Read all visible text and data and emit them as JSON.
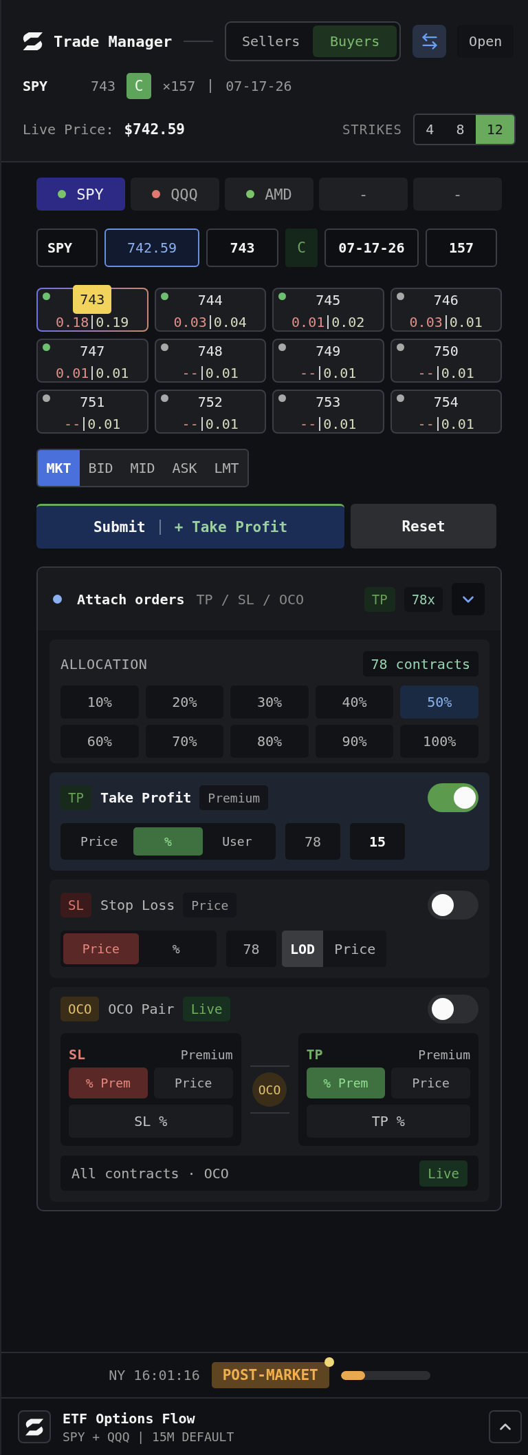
{
  "header": {
    "title": "Trade Manager",
    "side_tabs": [
      {
        "label": "Sellers",
        "selected": false
      },
      {
        "label": "Buyers",
        "selected": true
      }
    ],
    "open_button": "Open"
  },
  "contract": {
    "symbol": "SPY",
    "strike": "743",
    "type": "C",
    "quantity": "×157",
    "expiry": "07-17-26"
  },
  "live_price": {
    "label": "Live Price:",
    "value": "$742.59"
  },
  "strikes": {
    "label": "STRIKES",
    "options": [
      {
        "label": "4",
        "selected": false
      },
      {
        "label": "8",
        "selected": false
      },
      {
        "label": "12",
        "selected": true
      }
    ]
  },
  "tickers": [
    {
      "label": "SPY",
      "selected": true,
      "color": "#7cc46a"
    },
    {
      "label": "QQQ",
      "selected": false,
      "color": "#e07a6e"
    },
    {
      "label": "AMD",
      "selected": false,
      "color": "#7cc46a"
    },
    {
      "label": "-",
      "selected": false
    },
    {
      "label": "-",
      "selected": false
    }
  ],
  "order_fields": [
    {
      "kind": "input",
      "value": "SPY",
      "focused": false
    },
    {
      "kind": "input",
      "value": "742.59",
      "focused": true
    },
    {
      "kind": "input",
      "value": "743",
      "focused": false
    },
    {
      "kind": "tag",
      "value": "C"
    },
    {
      "kind": "input",
      "value": "07-17-26",
      "focused": false
    },
    {
      "kind": "input",
      "value": "157",
      "focused": false
    }
  ],
  "strike_grid": [
    {
      "strike": "743",
      "bid": "0.18",
      "ask": "0.19",
      "color": "#6cc070",
      "selected": true
    },
    {
      "strike": "744",
      "bid": "0.03",
      "ask": "0.04",
      "color": "#6cc070",
      "selected": false
    },
    {
      "strike": "745",
      "bid": "0.01",
      "ask": "0.02",
      "color": "#6cc070",
      "selected": false
    },
    {
      "strike": "746",
      "bid": "0.03",
      "ask": "0.01",
      "color": "#a8a8a8",
      "selected": false
    },
    {
      "strike": "747",
      "bid": "0.01",
      "ask": "0.01",
      "color": "#6cc070",
      "selected": false
    },
    {
      "strike": "748",
      "bid": "--",
      "ask": "0.01",
      "color": "#a8a8a8",
      "selected": false
    },
    {
      "strike": "749",
      "bid": "--",
      "ask": "0.01",
      "color": "#a8a8a8",
      "selected": false
    },
    {
      "strike": "750",
      "bid": "--",
      "ask": "0.01",
      "color": "#a8a8a8",
      "selected": false
    },
    {
      "strike": "751",
      "bid": "--",
      "ask": "0.01",
      "color": "#a8a8a8",
      "selected": false
    },
    {
      "strike": "752",
      "bid": "--",
      "ask": "0.01",
      "color": "#a8a8a8",
      "selected": false
    },
    {
      "strike": "753",
      "bid": "--",
      "ask": "0.01",
      "color": "#a8a8a8",
      "selected": false
    },
    {
      "strike": "754",
      "bid": "--",
      "ask": "0.01",
      "color": "#a8a8a8",
      "selected": false
    }
  ],
  "order_types": [
    {
      "label": "MKT",
      "selected": true
    },
    {
      "label": "BID",
      "selected": false
    },
    {
      "label": "MID",
      "selected": false
    },
    {
      "label": "ASK",
      "selected": false
    },
    {
      "label": "LMT",
      "selected": false
    }
  ],
  "actions": {
    "submit": "Submit",
    "submit_extra": "+ Take Profit",
    "reset": "Reset"
  },
  "attach_orders": {
    "title": "Attach orders",
    "subtitle": "TP / SL / OCO",
    "badges": [
      {
        "kind": "tp",
        "label": "TP"
      },
      {
        "kind": "count",
        "label": "78x"
      }
    ],
    "expanded": true,
    "allocation": {
      "label": "ALLOCATION",
      "contracts": "78 contracts",
      "options": [
        {
          "label": "10%",
          "selected": false
        },
        {
          "label": "20%",
          "selected": false
        },
        {
          "label": "30%",
          "selected": false
        },
        {
          "label": "40%",
          "selected": false
        },
        {
          "label": "50%",
          "selected": true
        },
        {
          "label": "60%",
          "selected": false
        },
        {
          "label": "70%",
          "selected": false
        },
        {
          "label": "80%",
          "selected": false
        },
        {
          "label": "90%",
          "selected": false
        },
        {
          "label": "100%",
          "selected": false
        }
      ]
    },
    "take_profit": {
      "badge": "TP",
      "title": "Take Profit",
      "mode": "Premium",
      "on": true,
      "modes": [
        {
          "label": "Price",
          "selected": false
        },
        {
          "label": "%",
          "selected": true
        },
        {
          "label": "User",
          "selected": false
        }
      ],
      "contracts": "78",
      "value": "15"
    },
    "stop_loss": {
      "badge": "SL",
      "title": "Stop Loss",
      "mode": "Price",
      "on": false,
      "modes": [
        {
          "label": "Price",
          "selected": true
        },
        {
          "label": "%",
          "selected": false
        }
      ],
      "contracts": "78",
      "anchors": [
        {
          "label": "LOD",
          "selected": true
        },
        {
          "label": "Price",
          "selected": false
        }
      ]
    },
    "oco_pair": {
      "badge": "OCO",
      "title": "OCO Pair",
      "status": "Live",
      "on": false,
      "legs": [
        {
          "kind": "sl",
          "label": "SL",
          "mode": "Premium",
          "options": [
            {
              "label": "% Prem",
              "selected": true
            },
            {
              "label": "Price",
              "selected": false
            }
          ],
          "placeholder": "SL %"
        },
        {
          "kind": "tp",
          "label": "TP",
          "mode": "Premium",
          "options": [
            {
              "label": "% Prem",
              "selected": true
            },
            {
              "label": "Price",
              "selected": false
            }
          ],
          "placeholder": "TP %"
        }
      ],
      "link": "OCO",
      "footer": "All contracts · OCO",
      "footer_status": "Live"
    }
  },
  "status_bar": {
    "clock": "NY 16:01:16",
    "session": "POST-MARKET",
    "level": 0.27
  },
  "footer": {
    "title": "ETF Options Flow",
    "subtitle": "SPY + QQQ | 15M DEFAULT"
  }
}
